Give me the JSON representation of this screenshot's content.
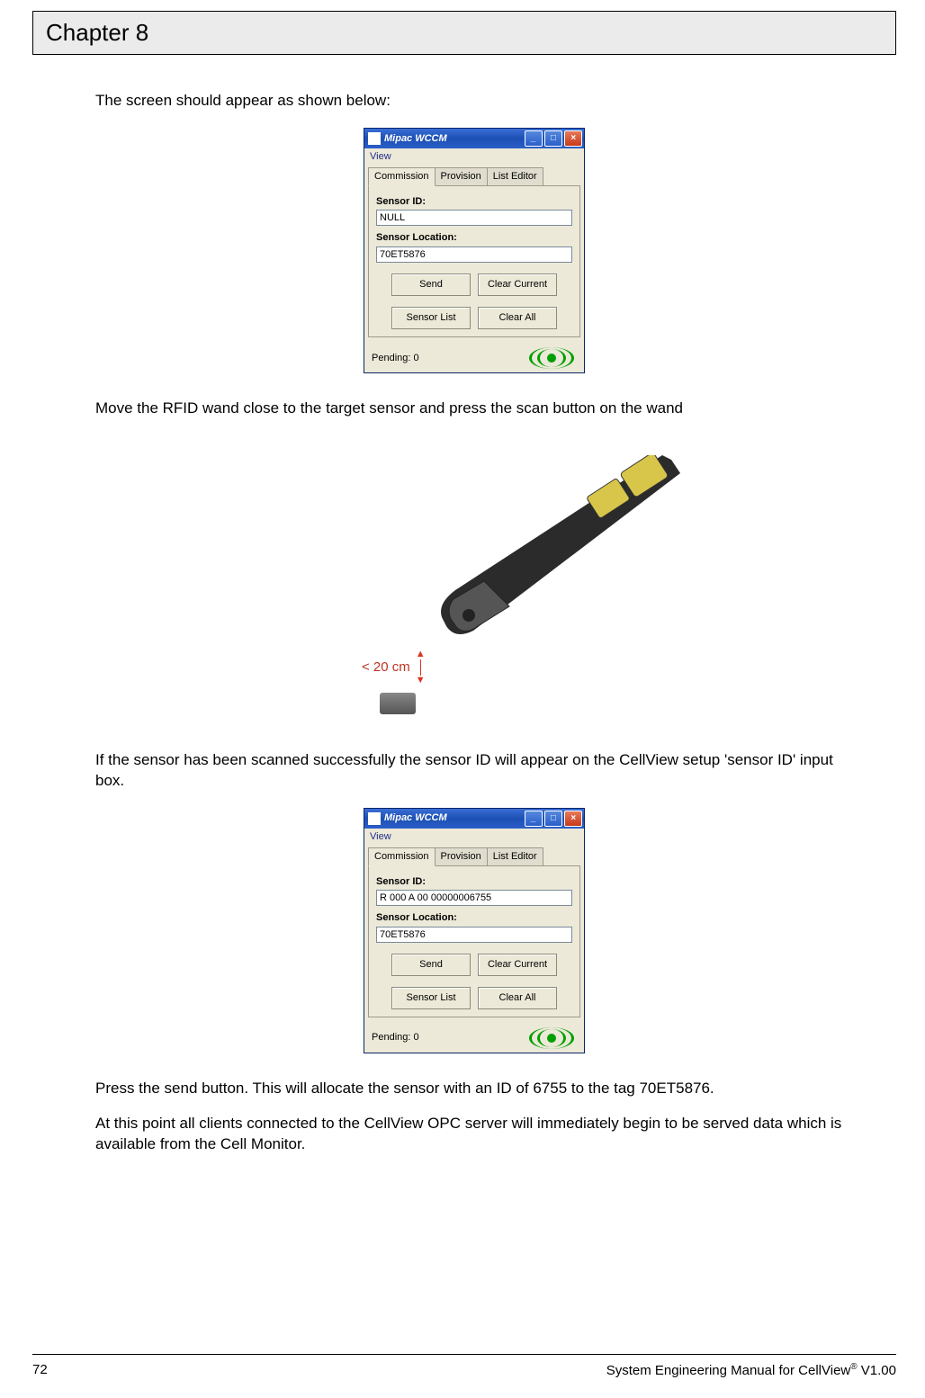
{
  "chapter_title": "Chapter 8",
  "body": {
    "p1": "The screen should appear as shown below:",
    "p2": "Move the RFID wand close to the target sensor and press the scan button on the wand",
    "p3": "If the sensor has been scanned successfully the sensor ID will appear on the CellView setup 'sensor ID' input box.",
    "p4": "Press the send button. This will allocate the sensor with an ID of 6755 to the tag 70ET5876.",
    "p5": "At this point all clients connected to the CellView OPC server will immediately begin to be served data which is available from the Cell Monitor."
  },
  "window1": {
    "title": "Mipac WCCM",
    "menu_view": "View",
    "tabs": {
      "commission": "Commission",
      "provision": "Provision",
      "list_editor": "List Editor"
    },
    "labels": {
      "sensor_id": "Sensor ID:",
      "sensor_location": "Sensor Location:"
    },
    "values": {
      "sensor_id": "NULL",
      "sensor_location": "70ET5876"
    },
    "buttons": {
      "send": "Send",
      "clear_current": "Clear Current",
      "sensor_list": "Sensor List",
      "clear_all": "Clear All"
    },
    "pending": "Pending: 0"
  },
  "window2": {
    "title": "Mipac WCCM",
    "menu_view": "View",
    "tabs": {
      "commission": "Commission",
      "provision": "Provision",
      "list_editor": "List Editor"
    },
    "labels": {
      "sensor_id": "Sensor ID:",
      "sensor_location": "Sensor Location:"
    },
    "values": {
      "sensor_id": "R 000 A 00 00000006755",
      "sensor_location": "70ET5876"
    },
    "buttons": {
      "send": "Send",
      "clear_current": "Clear Current",
      "sensor_list": "Sensor List",
      "clear_all": "Clear All"
    },
    "pending": "Pending: 0"
  },
  "wand": {
    "distance_label": "< 20 cm"
  },
  "footer": {
    "page_number": "72",
    "doc_title": "System Engineering Manual for CellView",
    "reg": "®",
    "version": " V1.00"
  }
}
